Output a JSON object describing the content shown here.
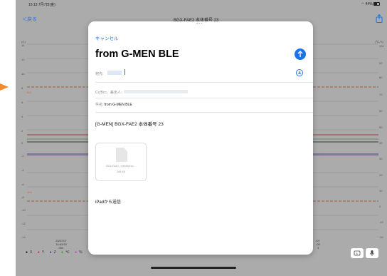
{
  "statusbar": {
    "time": "15:13",
    "date": "7月7日(金)",
    "battery": "44%"
  },
  "background_app": {
    "back_label": "＜戻る",
    "title": "BGX-FAE2 本体番号 23",
    "y_left_unit": "(G)",
    "y_right_unit": "(℃,%)",
    "y_left_ticks": [
      "14",
      "12",
      "10",
      "8",
      "6",
      "4",
      "2",
      "0",
      "-2",
      "-4",
      "-6",
      "-8",
      "-10",
      "-12",
      "-14"
    ],
    "y_right_ticks": [
      "100",
      "90",
      "80",
      "70",
      "60",
      "50",
      "40",
      "30",
      "20",
      "10",
      "0",
      "-10",
      "-20"
    ],
    "threshold_upper": "8.0",
    "threshold_lower": "-8.0",
    "x_label_left": [
      "23/07/07",
      "14:54:50",
      "000"
    ],
    "x_label_right": [
      "/07",
      ":03",
      "3"
    ],
    "legend": [
      {
        "dot": "●",
        "label": "X",
        "color": "#000000"
      },
      {
        "dot": "●",
        "label": "Y",
        "color": "#dd2222"
      },
      {
        "dot": "●",
        "label": "Z",
        "color": "#3333cc"
      },
      {
        "dot": "●",
        "label": "℃",
        "color": "#22aa22"
      },
      {
        "dot": "●",
        "label": "%",
        "color": "#cc33cc"
      }
    ]
  },
  "mail": {
    "cancel_label": "キャンセル",
    "subject_heading": "from G-MEN BLE",
    "to_label": "宛先:",
    "cc_label": "Cc/Bcc、差出人:",
    "subject_label": "件名:",
    "subject_value": "from G-MEN BLE",
    "body_line": "[G-MEN] BGX-FAE2 本体番号 23",
    "attachment_name": "BGX-FAE2_1(5045)Exp...",
    "attachment_size": "208 KB",
    "signature": "iPadから送信"
  },
  "colors": {
    "accent": "#1a73e8",
    "marker": "#f08d2b"
  }
}
